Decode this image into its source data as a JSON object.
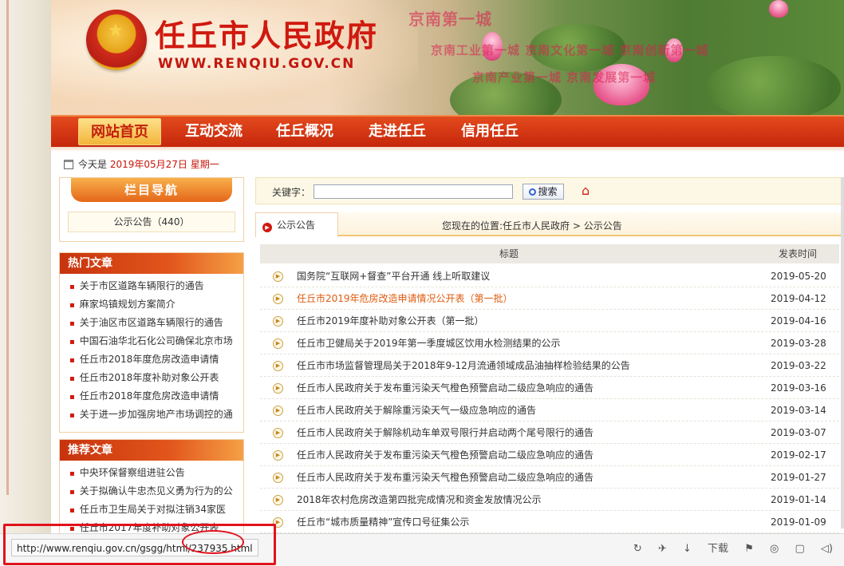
{
  "header": {
    "site_title": "任丘市人民政府",
    "site_url": "WWW.RENQIU.GOV.CN",
    "slogans": [
      "京南第一城",
      "京南工业第一城 京南文化第一城 京南创新第一城",
      "京南产业第一城 京南发展第一城"
    ]
  },
  "nav": {
    "items": [
      {
        "label": "网站首页",
        "active": true
      },
      {
        "label": "互动交流",
        "active": false
      },
      {
        "label": "任丘概况",
        "active": false
      },
      {
        "label": "走进任丘",
        "active": false
      },
      {
        "label": "信用任丘",
        "active": false
      }
    ]
  },
  "date": {
    "prefix": "今天是",
    "date": "2019年05月27日",
    "weekday": "星期一"
  },
  "sidebar": {
    "nav_title": "栏目导航",
    "nav_item": "公示公告（440）",
    "hot_title": "热门文章",
    "hot_items": [
      "关于市区道路车辆限行的通告",
      "麻家坞镇规划方案简介",
      "关于油区市区道路车辆限行的通告",
      "中国石油华北石化公司确保北京市场",
      "任丘市2018年度危房改造申请情",
      "任丘市2018年度补助对象公开表",
      "任丘市2018年度危房改造申请情",
      "关于进一步加强房地产市场调控的通"
    ],
    "rec_title": "推荐文章",
    "rec_items": [
      "中央环保督察组进驻公告",
      "关于拟确认牛忠杰见义勇为行为的公",
      "任丘市卫生局关于对拟注销34家医",
      "任丘市2017年度补助对象公开表"
    ]
  },
  "search": {
    "label": "关键字：",
    "value": "",
    "button": "搜索"
  },
  "tab": {
    "label": "公示公告",
    "breadcrumb": "您现在的位置:任丘市人民政府 > 公示公告"
  },
  "table": {
    "col_title": "标题",
    "col_date": "发表时间",
    "rows": [
      {
        "title": "国务院“互联网+督查”平台开通 线上听取建议",
        "date": "2019-05-20",
        "highlight": false
      },
      {
        "title": "任丘市2019年危房改造申请情况公开表（第一批）",
        "date": "2019-04-12",
        "highlight": true
      },
      {
        "title": "任丘市2019年度补助对象公开表（第一批）",
        "date": "2019-04-16",
        "highlight": false
      },
      {
        "title": "任丘市卫健局关于2019年第一季度城区饮用水检测结果的公示",
        "date": "2019-03-28",
        "highlight": false
      },
      {
        "title": "任丘市市场监督管理局关于2018年9-12月流通领域成品油抽样检验结果的公告",
        "date": "2019-03-22",
        "highlight": false
      },
      {
        "title": "任丘市人民政府关于发布重污染天气橙色预警启动二级应急响应的通告",
        "date": "2019-03-16",
        "highlight": false
      },
      {
        "title": "任丘市人民政府关于解除重污染天气一级应急响应的通告",
        "date": "2019-03-14",
        "highlight": false
      },
      {
        "title": "任丘市人民政府关于解除机动车单双号限行并启动两个尾号限行的通告",
        "date": "2019-03-07",
        "highlight": false
      },
      {
        "title": "任丘市人民政府关于发布重污染天气橙色预警启动二级应急响应的通告",
        "date": "2019-02-17",
        "highlight": false
      },
      {
        "title": "任丘市人民政府关于发布重污染天气橙色预警启动二级应急响应的通告",
        "date": "2019-01-27",
        "highlight": false
      },
      {
        "title": "2018年农村危房改造第四批完成情况和资金发放情况公示",
        "date": "2019-01-14",
        "highlight": false
      },
      {
        "title": "任丘市“城市质量精神”宣传口号征集公示",
        "date": "2019-01-09",
        "highlight": false
      }
    ]
  },
  "statusbar": {
    "url": "http://www.renqiu.gov.cn/gsgg/html/237935.html",
    "download_label": "下载"
  },
  "colors": {
    "brand_red": "#d0190f",
    "nav_orange": "#e34a1d",
    "highlight_orange": "#e05a0c",
    "annotation_red": "#e2121c"
  }
}
